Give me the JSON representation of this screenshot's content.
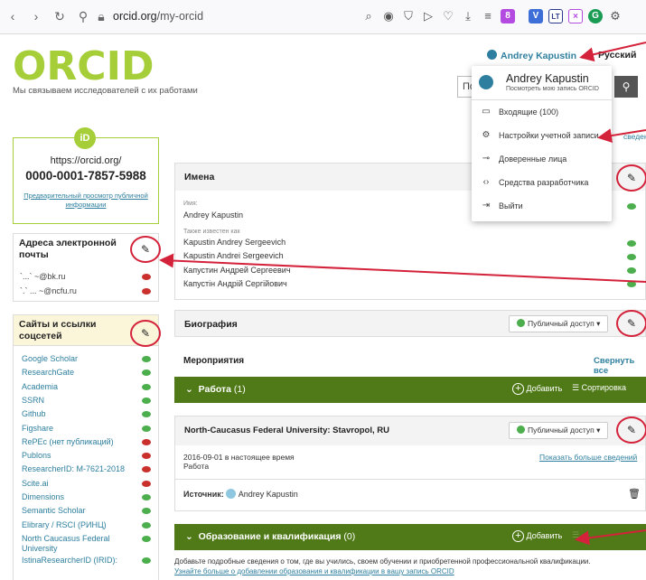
{
  "browser": {
    "url_domain": "orcid.org",
    "url_path": "/my-orcid",
    "ext_badge": "8",
    "ext_v": "V",
    "ext_lt": "LT",
    "ext_x": "×",
    "ext_g": "G"
  },
  "header": {
    "logo_text": "ORCID",
    "tagline": "Мы связываем исследователей с их работами",
    "user_name": "Andrey Kapustin",
    "language": "Русский",
    "search_fragment": "По"
  },
  "dropdown": {
    "name": "Andrey Kapustin",
    "subtitle": "Посмотреть мою запись ORCID",
    "items": [
      {
        "label": "Входящие (100)"
      },
      {
        "label": "Настройки учетной записи"
      },
      {
        "label": "Доверенные лица"
      },
      {
        "label": "Средства разработчика"
      },
      {
        "label": "Выйти"
      }
    ]
  },
  "idcard": {
    "badge": "iD",
    "url": "https://orcid.org/",
    "number": "0000-0001-7857-5988",
    "preview_link": "Предварительный просмотр публичной информации"
  },
  "emails": {
    "title": "Адреса электронной почты",
    "items": [
      "`...` ~@bk.ru",
      "`.` ... ~@ncfu.ru"
    ]
  },
  "sites": {
    "title": "Сайты и ссылки соцсетей",
    "items": [
      {
        "label": "Google Scholar",
        "vis": "g"
      },
      {
        "label": "ResearchGate",
        "vis": "g"
      },
      {
        "label": "Academia",
        "vis": "g"
      },
      {
        "label": "SSRN",
        "vis": "g"
      },
      {
        "label": "Github",
        "vis": "g"
      },
      {
        "label": "Figshare",
        "vis": "g"
      },
      {
        "label": "RePEc (нет публикаций)",
        "vis": "r"
      },
      {
        "label": "Publons",
        "vis": "r"
      },
      {
        "label": "ResearcherID: M-7621-2018",
        "vis": "r"
      },
      {
        "label": "Scite.ai",
        "vis": "r"
      },
      {
        "label": "Dimensions",
        "vis": "g"
      },
      {
        "label": "Semantic Scholar",
        "vis": "g"
      },
      {
        "label": "Elibrary / RSCI (РИНЦ)",
        "vis": "g"
      },
      {
        "label": "North Caucasus Federal University",
        "vis": "g"
      },
      {
        "label": "IstinaResearcherID (IRID):",
        "vis": "g"
      }
    ]
  },
  "names": {
    "title": "Имена",
    "name_label": "Имя:",
    "name_value": "Andrey Kapustin",
    "aka_label": "Также известен как",
    "aka": [
      "Kapustin Andrey Sergeevich",
      "Kapustin Andrei Sergeevich",
      "Капустин Андрей Сергеевич",
      "Капустін Андрій Сергійович"
    ],
    "right_frag": "сведения"
  },
  "bio": {
    "title": "Биография",
    "public": "Публичный доступ"
  },
  "activities": {
    "title": "Мероприятия",
    "collapse": "Свернуть все"
  },
  "works": {
    "title": "Работа",
    "count": "(1)",
    "add": "Добавить",
    "sort": "Сортировка"
  },
  "employment": {
    "title": "North-Caucasus Federal University: Stavropol, RU",
    "public": "Публичный доступ",
    "dates": "2016-09-01 в настоящее время",
    "role": "Работа",
    "more": "Показать больше сведений",
    "source_label": "Источник:",
    "source_value": "Andrey Kapustin"
  },
  "education": {
    "title": "Образование и квалификация",
    "count": "(0)",
    "add": "Добавить",
    "desc": "Добавьте подробные сведения о том, где вы учились, своем обучении и приобретенной профессиональной квалификации.",
    "link": "Узнайте больше о добавлении образования и квалификации в вашу запись ORCID"
  },
  "colors": {
    "orcid_green": "#a6ce39",
    "dark_green": "#4f7a17",
    "link": "#2e7f9f",
    "annotation_red": "#d3223a"
  }
}
